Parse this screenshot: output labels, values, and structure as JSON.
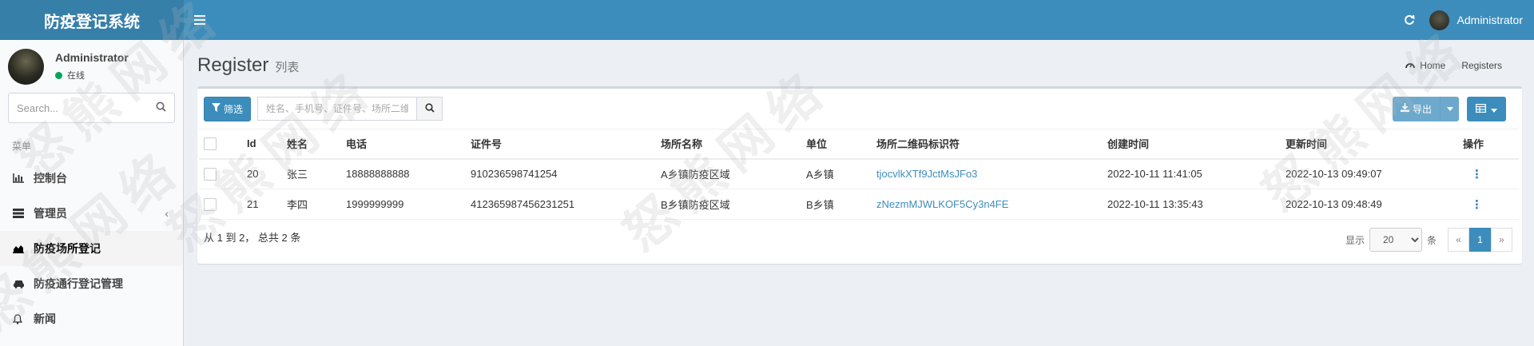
{
  "app": {
    "title": "防疫登记系统",
    "user": "Administrator"
  },
  "sidebar": {
    "user_name": "Administrator",
    "status": "在线",
    "search_placeholder": "Search...",
    "menu_header": "菜单",
    "items": [
      {
        "label": "控制台",
        "icon": "bar-chart-icon"
      },
      {
        "label": "管理员",
        "icon": "list-icon"
      },
      {
        "label": "防疫场所登记",
        "icon": "area-chart-icon"
      },
      {
        "label": "防疫通行登记管理",
        "icon": "car-icon"
      },
      {
        "label": "新闻",
        "icon": "bell-icon"
      }
    ]
  },
  "page": {
    "title": "Register",
    "subtitle": "列表"
  },
  "breadcrumb": {
    "home": "Home",
    "current": "Registers"
  },
  "toolbar": {
    "filter_label": "筛选",
    "search_placeholder": "姓名、手机号、证件号、场所二维码标识符",
    "export_label": "导出"
  },
  "table": {
    "headers": [
      "Id",
      "姓名",
      "电话",
      "证件号",
      "场所名称",
      "单位",
      "场所二维码标识符",
      "创建时间",
      "更新时间",
      "操作"
    ],
    "rows": [
      {
        "id": "20",
        "name": "张三",
        "phone": "18888888888",
        "idcard": "910236598741254",
        "place": "A乡镇防疫区域",
        "unit": "A乡镇",
        "qr": "tjocvlkXTf9JctMsJFo3",
        "created": "2022-10-11 11:41:05",
        "updated": "2022-10-13 09:49:07"
      },
      {
        "id": "21",
        "name": "李四",
        "phone": "1999999999",
        "idcard": "412365987456231251",
        "place": "B乡镇防疫区域",
        "unit": "B乡镇",
        "qr": "zNezmMJWLKOF5Cy3n4FE",
        "created": "2022-10-11 13:35:43",
        "updated": "2022-10-13 09:48:49"
      }
    ]
  },
  "footer": {
    "summary": "从 1 到 2， 总共 2 条",
    "show_label": "显示",
    "per_page": "20",
    "per_page_suffix": "条",
    "prev": "«",
    "page": "1",
    "next": "»"
  },
  "watermark": "怒熊网络",
  "colors": {
    "primary": "#3c8dbc",
    "header_logo": "#367fa9",
    "online": "#00a65a"
  }
}
